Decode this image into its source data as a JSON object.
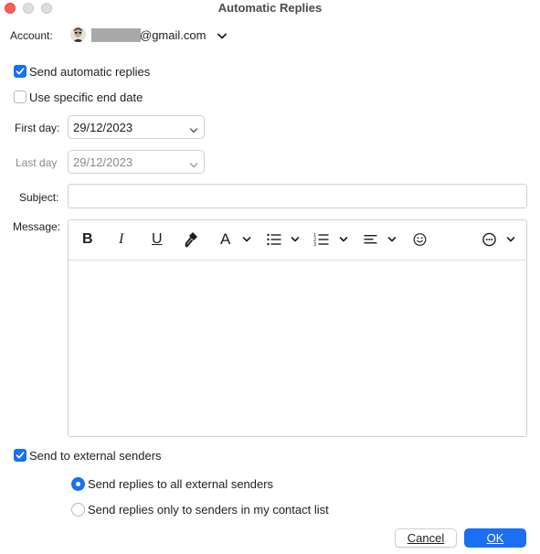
{
  "window": {
    "title": "Automatic Replies"
  },
  "account": {
    "label": "Account:",
    "email_suffix": "@gmail.com",
    "icon": "chevron-down-icon"
  },
  "options": {
    "send_automatic_replies": {
      "label": "Send automatic replies",
      "checked": true
    },
    "use_specific_end_date": {
      "label": "Use specific end date",
      "checked": false
    }
  },
  "dates": {
    "first_day_label": "First day:",
    "first_day_value": "29/12/2023",
    "last_day_label": "Last day",
    "last_day_value": "29/12/2023"
  },
  "subject": {
    "label": "Subject:",
    "value": ""
  },
  "message": {
    "label": "Message:",
    "value": "",
    "toolbar": [
      {
        "name": "bold-icon",
        "glyph": "B"
      },
      {
        "name": "italic-icon",
        "glyph": "I"
      },
      {
        "name": "underline-icon",
        "glyph": "U"
      },
      {
        "name": "format-painter-icon"
      },
      {
        "name": "font-color-icon",
        "glyph": "A"
      },
      {
        "name": "bulleted-list-icon"
      },
      {
        "name": "numbered-list-icon"
      },
      {
        "name": "align-icon"
      },
      {
        "name": "emoji-icon"
      },
      {
        "name": "more-options-icon"
      }
    ]
  },
  "external": {
    "send_to_external": {
      "label": "Send to external senders",
      "checked": true
    },
    "radio_all": {
      "label": "Send replies to all external senders",
      "selected": true
    },
    "radio_contacts": {
      "label": "Send replies only to senders in my contact list",
      "selected": false
    }
  },
  "buttons": {
    "cancel": "Cancel",
    "ok": "OK"
  },
  "colors": {
    "accent": "#1a6ff2",
    "close_button": "#fe5f57"
  }
}
